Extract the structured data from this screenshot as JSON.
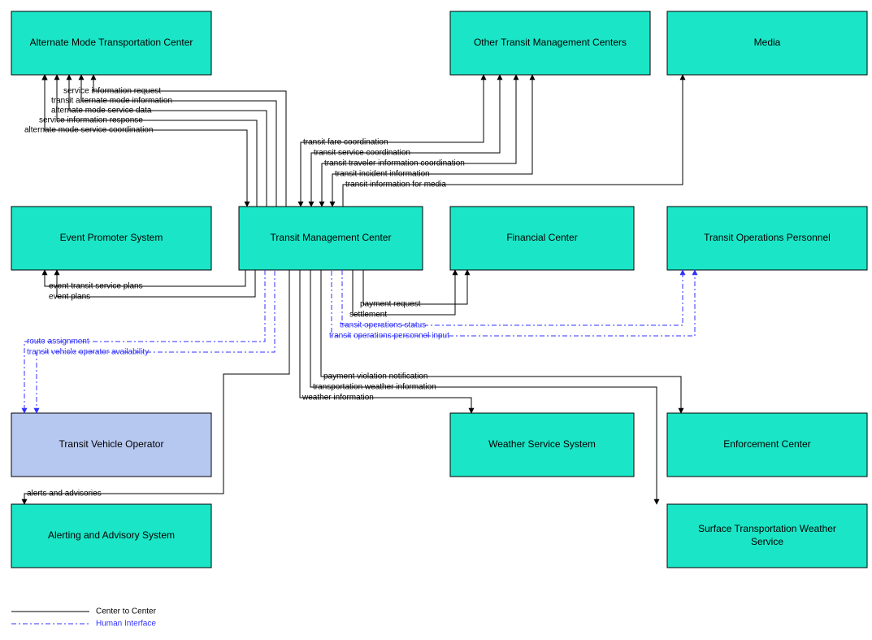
{
  "nodes": {
    "alt_mode": "Alternate Mode Transportation Center",
    "other_tmc": "Other Transit Management Centers",
    "media": "Media",
    "event_promoter": "Event Promoter System",
    "tmc": "Transit Management Center",
    "financial": "Financial Center",
    "top": "Transit Operations Personnel",
    "tvo": "Transit Vehicle Operator",
    "weather_svc": "Weather Service System",
    "enforcement": "Enforcement Center",
    "alerting": "Alerting and Advisory System",
    "stws": "Surface Transportation Weather Service"
  },
  "flows": {
    "svc_info_req": "service information request",
    "transit_alt_mode_info": "transit alternate mode information",
    "alt_mode_svc_data": "alternate mode service data",
    "svc_info_resp": "service information response",
    "alt_mode_svc_coord": "alternate mode service coordination",
    "fare_coord": "transit fare coordination",
    "svc_coord": "transit service coordination",
    "trav_info_coord": "transit traveler information coordination",
    "incident_info": "transit incident information",
    "info_for_media": "transit information for media",
    "event_transit_plans": "event transit service plans",
    "event_plans": "event plans",
    "payment_request": "payment request",
    "settlement": "settlement",
    "ops_status": "transit operations status",
    "ops_personnel_input": "transit operations personnel input",
    "route_assignment": "route assignment",
    "tv_operator_avail": "transit vehicle operator availability",
    "payment_violation": "payment violation notification",
    "transport_weather": "transportation weather information",
    "weather_info": "weather information",
    "alerts_advisories": "alerts and advisories"
  },
  "legend": {
    "c2c": "Center to Center",
    "hi": "Human Interface"
  },
  "chart_data": {
    "type": "node-link-diagram",
    "nodes": [
      {
        "id": "alt_mode",
        "label": "Alternate Mode Transportation Center",
        "kind": "center"
      },
      {
        "id": "other_tmc",
        "label": "Other Transit Management Centers",
        "kind": "center"
      },
      {
        "id": "media",
        "label": "Media",
        "kind": "center"
      },
      {
        "id": "event_promoter",
        "label": "Event Promoter System",
        "kind": "center"
      },
      {
        "id": "tmc",
        "label": "Transit Management Center",
        "kind": "center"
      },
      {
        "id": "financial",
        "label": "Financial Center",
        "kind": "center"
      },
      {
        "id": "top",
        "label": "Transit Operations Personnel",
        "kind": "center"
      },
      {
        "id": "tvo",
        "label": "Transit Vehicle Operator",
        "kind": "human"
      },
      {
        "id": "weather_svc",
        "label": "Weather Service System",
        "kind": "center"
      },
      {
        "id": "enforcement",
        "label": "Enforcement Center",
        "kind": "center"
      },
      {
        "id": "alerting",
        "label": "Alerting and Advisory System",
        "kind": "center"
      },
      {
        "id": "stws",
        "label": "Surface Transportation Weather Service",
        "kind": "center"
      }
    ],
    "links": [
      {
        "from": "tmc",
        "to": "alt_mode",
        "label": "service information request",
        "type": "c2c"
      },
      {
        "from": "tmc",
        "to": "alt_mode",
        "label": "transit alternate mode information",
        "type": "c2c"
      },
      {
        "from": "alt_mode",
        "to": "tmc",
        "label": "alternate mode service data",
        "type": "c2c"
      },
      {
        "from": "alt_mode",
        "to": "tmc",
        "label": "service information response",
        "type": "c2c"
      },
      {
        "from": "alt_mode",
        "to": "tmc",
        "label": "alternate mode service coordination",
        "type": "c2c",
        "bidirectional": true
      },
      {
        "from": "tmc",
        "to": "other_tmc",
        "label": "transit fare coordination",
        "type": "c2c",
        "bidirectional": true
      },
      {
        "from": "tmc",
        "to": "other_tmc",
        "label": "transit service coordination",
        "type": "c2c",
        "bidirectional": true
      },
      {
        "from": "tmc",
        "to": "other_tmc",
        "label": "transit traveler information coordination",
        "type": "c2c",
        "bidirectional": true
      },
      {
        "from": "tmc",
        "to": "other_tmc",
        "label": "transit incident information",
        "type": "c2c",
        "bidirectional": true
      },
      {
        "from": "tmc",
        "to": "media",
        "label": "transit information for media",
        "type": "c2c"
      },
      {
        "from": "tmc",
        "to": "event_promoter",
        "label": "event transit service plans",
        "type": "c2c"
      },
      {
        "from": "event_promoter",
        "to": "tmc",
        "label": "event plans",
        "type": "c2c"
      },
      {
        "from": "tmc",
        "to": "financial",
        "label": "payment request",
        "type": "c2c"
      },
      {
        "from": "financial",
        "to": "tmc",
        "label": "settlement",
        "type": "c2c"
      },
      {
        "from": "tmc",
        "to": "top",
        "label": "transit operations status",
        "type": "hi"
      },
      {
        "from": "top",
        "to": "tmc",
        "label": "transit operations personnel input",
        "type": "hi"
      },
      {
        "from": "tmc",
        "to": "tvo",
        "label": "route assignment",
        "type": "hi"
      },
      {
        "from": "tvo",
        "to": "tmc",
        "label": "transit vehicle operator availability",
        "type": "hi"
      },
      {
        "from": "tmc",
        "to": "enforcement",
        "label": "payment violation notification",
        "type": "c2c"
      },
      {
        "from": "stws",
        "to": "tmc",
        "label": "transportation weather information",
        "type": "c2c"
      },
      {
        "from": "weather_svc",
        "to": "tmc",
        "label": "weather information",
        "type": "c2c"
      },
      {
        "from": "alerting",
        "to": "tmc",
        "label": "alerts and advisories",
        "type": "c2c"
      }
    ],
    "legend": [
      {
        "type": "c2c",
        "label": "Center to Center",
        "style": "solid-black"
      },
      {
        "type": "hi",
        "label": "Human Interface",
        "style": "dash-dot-blue"
      }
    ]
  }
}
